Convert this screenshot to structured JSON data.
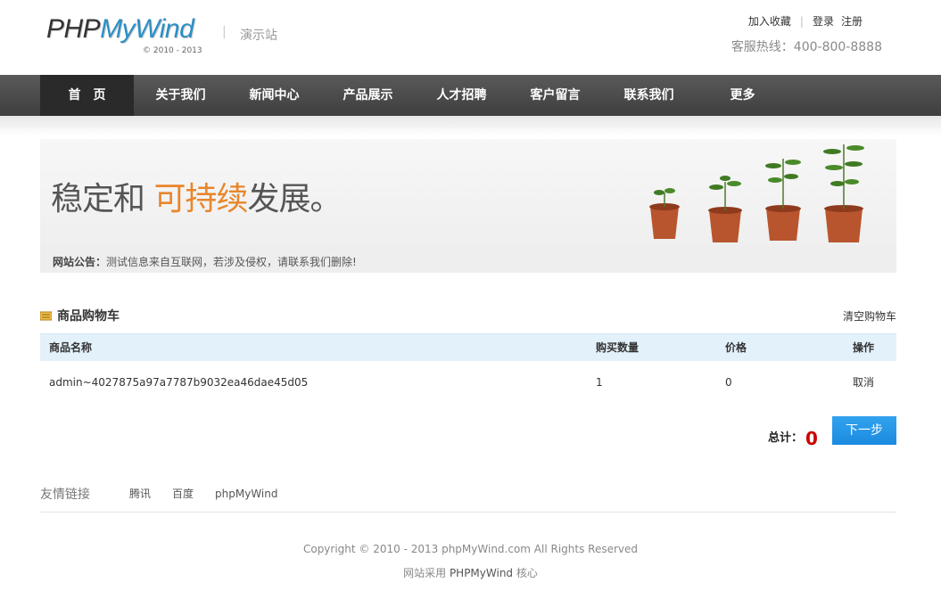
{
  "header": {
    "logo_php": "PHP",
    "logo_mywind": "MyWind",
    "logo_copy": "© 2010 - 2013",
    "logo_sep": "|",
    "site_label": "演示站",
    "links": {
      "favorite": "加入收藏",
      "sep": "|",
      "login": "登录",
      "register": "注册"
    },
    "hotline": "客服热线：400-800-8888"
  },
  "nav": {
    "items": [
      {
        "label": "首　页",
        "active": true
      },
      {
        "label": "关于我们"
      },
      {
        "label": "新闻中心"
      },
      {
        "label": "产品展示"
      },
      {
        "label": "人才招聘"
      },
      {
        "label": "客户留言"
      },
      {
        "label": "联系我们"
      },
      {
        "label": "更多"
      }
    ]
  },
  "banner": {
    "slogan_a": "稳定和 ",
    "slogan_b": "可持续",
    "slogan_c": "发展。",
    "notice_label": "网站公告：",
    "notice_text": "测试信息来自互联网，若涉及侵权，请联系我们删除!"
  },
  "cart": {
    "title": "商品购物车",
    "clear": "清空购物车",
    "columns": {
      "name": "商品名称",
      "qty": "购买数量",
      "price": "价格",
      "op": "操作"
    },
    "rows": [
      {
        "name": "admin~4027875a97a7787b9032ea46dae45d05",
        "qty": "1",
        "price": "0",
        "op": "取消"
      }
    ],
    "total_label": "总计：",
    "total_value": "0",
    "next_label": "下一步"
  },
  "friends": {
    "title": "友情链接",
    "links": [
      "腾讯",
      "百度",
      "phpMyWind"
    ]
  },
  "footer": {
    "copyright": "Copyright © 2010 - 2013 phpMyWind.com All Rights Reserved",
    "power_prefix": "网站采用 ",
    "power_brand": "PHPMyWind",
    "power_suffix": " 核心"
  },
  "colors": {
    "accent_blue": "#2a8fc4",
    "slogan_orange": "#e8862a",
    "total_red": "#cc0000",
    "button_blue": "#1b8ae0",
    "nav_dark": "#3e3e3e"
  }
}
